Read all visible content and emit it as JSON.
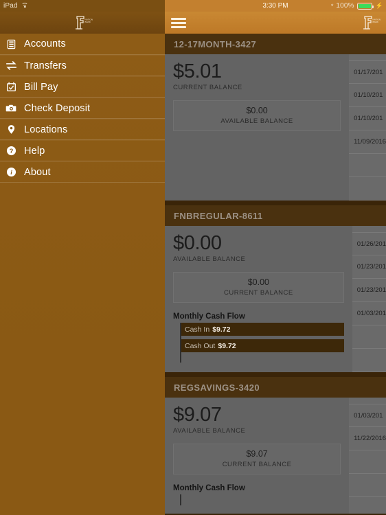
{
  "status_bar": {
    "device": "iPad",
    "wifi_icon": "wifi-icon",
    "time": "3:30 PM",
    "bluetooth_icon": "bluetooth-icon",
    "battery_percent": "100%",
    "battery_icon": "battery-icon",
    "charging_icon": "charging-bolt-icon",
    "battery_fill_color": "#3ddc5a"
  },
  "brand": {
    "logo_name": "first-national-bank-logo",
    "logo_line1": "NATIONAL",
    "logo_line2": "BANK"
  },
  "sidebar": {
    "menu_toggle_icon": "hamburger-menu-icon",
    "items": [
      {
        "label": "Accounts",
        "icon": "accounts-drawer-icon"
      },
      {
        "label": "Transfers",
        "icon": "transfer-arrows-icon"
      },
      {
        "label": "Bill Pay",
        "icon": "calendar-check-icon"
      },
      {
        "label": "Check Deposit",
        "icon": "camera-icon"
      },
      {
        "label": "Locations",
        "icon": "map-pin-icon"
      },
      {
        "label": "Help",
        "icon": "question-circle-icon"
      },
      {
        "label": "About",
        "icon": "info-circle-icon"
      }
    ]
  },
  "accounts": [
    {
      "name": "12-17MONTH-3427",
      "primary_amount": "$5.01",
      "primary_label": "CURRENT BALANCE",
      "secondary_amount": "$0.00",
      "secondary_label": "AVAILABLE BALANCE",
      "cash_flow": null,
      "transactions": [
        {
          "date": "01/17/201"
        },
        {
          "date": "01/10/201"
        },
        {
          "date": "01/10/201"
        },
        {
          "date": "11/09/2016"
        },
        {
          "date": ""
        },
        {
          "date": ""
        }
      ]
    },
    {
      "name": "FNBREGULAR-8611",
      "primary_amount": "$0.00",
      "primary_label": "AVAILABLE BALANCE",
      "secondary_amount": "$0.00",
      "secondary_label": "CURRENT BALANCE",
      "cash_flow": {
        "title": "Monthly Cash Flow",
        "bars": [
          {
            "name": "Cash In",
            "value": "$9.72",
            "width_pct": 100
          },
          {
            "name": "Cash Out",
            "value": "$9.72",
            "width_pct": 100
          }
        ]
      },
      "transactions": [
        {
          "date": "01/26/201"
        },
        {
          "date": "01/23/201"
        },
        {
          "date": "01/23/201"
        },
        {
          "date": "01/03/201"
        },
        {
          "date": ""
        },
        {
          "date": ""
        }
      ]
    },
    {
      "name": "REGSAVINGS-3420",
      "primary_amount": "$9.07",
      "primary_label": "AVAILABLE BALANCE",
      "secondary_amount": "$9.07",
      "secondary_label": "CURRENT BALANCE",
      "cash_flow": {
        "title": "Monthly Cash Flow",
        "bars": []
      },
      "transactions": [
        {
          "date": "01/03/201"
        },
        {
          "date": "11/22/2016"
        },
        {
          "date": ""
        },
        {
          "date": ""
        }
      ]
    }
  ],
  "colors": {
    "sidebar_brown": "#8a5914",
    "header_orange": "#c3802f",
    "card_header_brown": "#4a310f",
    "card_gray": "#636363",
    "bar_brown": "#3d2809"
  }
}
